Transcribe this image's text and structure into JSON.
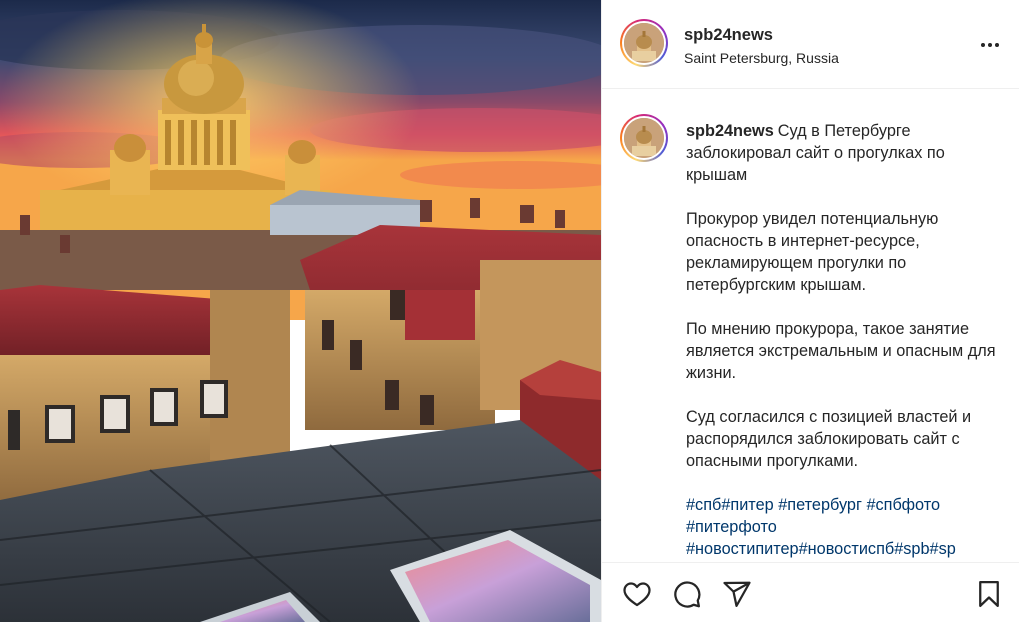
{
  "post": {
    "username": "spb24news",
    "location": "Saint Petersburg, Russia"
  },
  "caption": {
    "username": "spb24news",
    "headline": "Суд в Петербурге заблокировал сайт о прогулках по крышам",
    "paragraphs": [
      "Прокурор увидел потенциальную опасность в интернет-ресурсе, рекламирующем прогулки по петербургским крышам.",
      "По мнению прокурора, такое занятие является экстремальным и опасным для жизни.",
      "Суд согласился с позицией властей и распорядился заблокировать сайт с опасными прогулками."
    ],
    "hashtags_line1": [
      "#спб",
      "#питер",
      " #петербург",
      " #спбфото"
    ],
    "hashtags_line2": [
      "#питерфото"
    ],
    "hashtags_line3": [
      "#новостипитер",
      "#новостиспб",
      "#spb",
      "#sp"
    ]
  },
  "icons": {
    "more": "more-options-icon",
    "like": "heart-icon",
    "comment": "comment-icon",
    "share": "paper-plane-icon",
    "save": "bookmark-icon"
  },
  "colors": {
    "text": "#262626",
    "hashtag": "#00376b",
    "divider": "#efefef"
  }
}
